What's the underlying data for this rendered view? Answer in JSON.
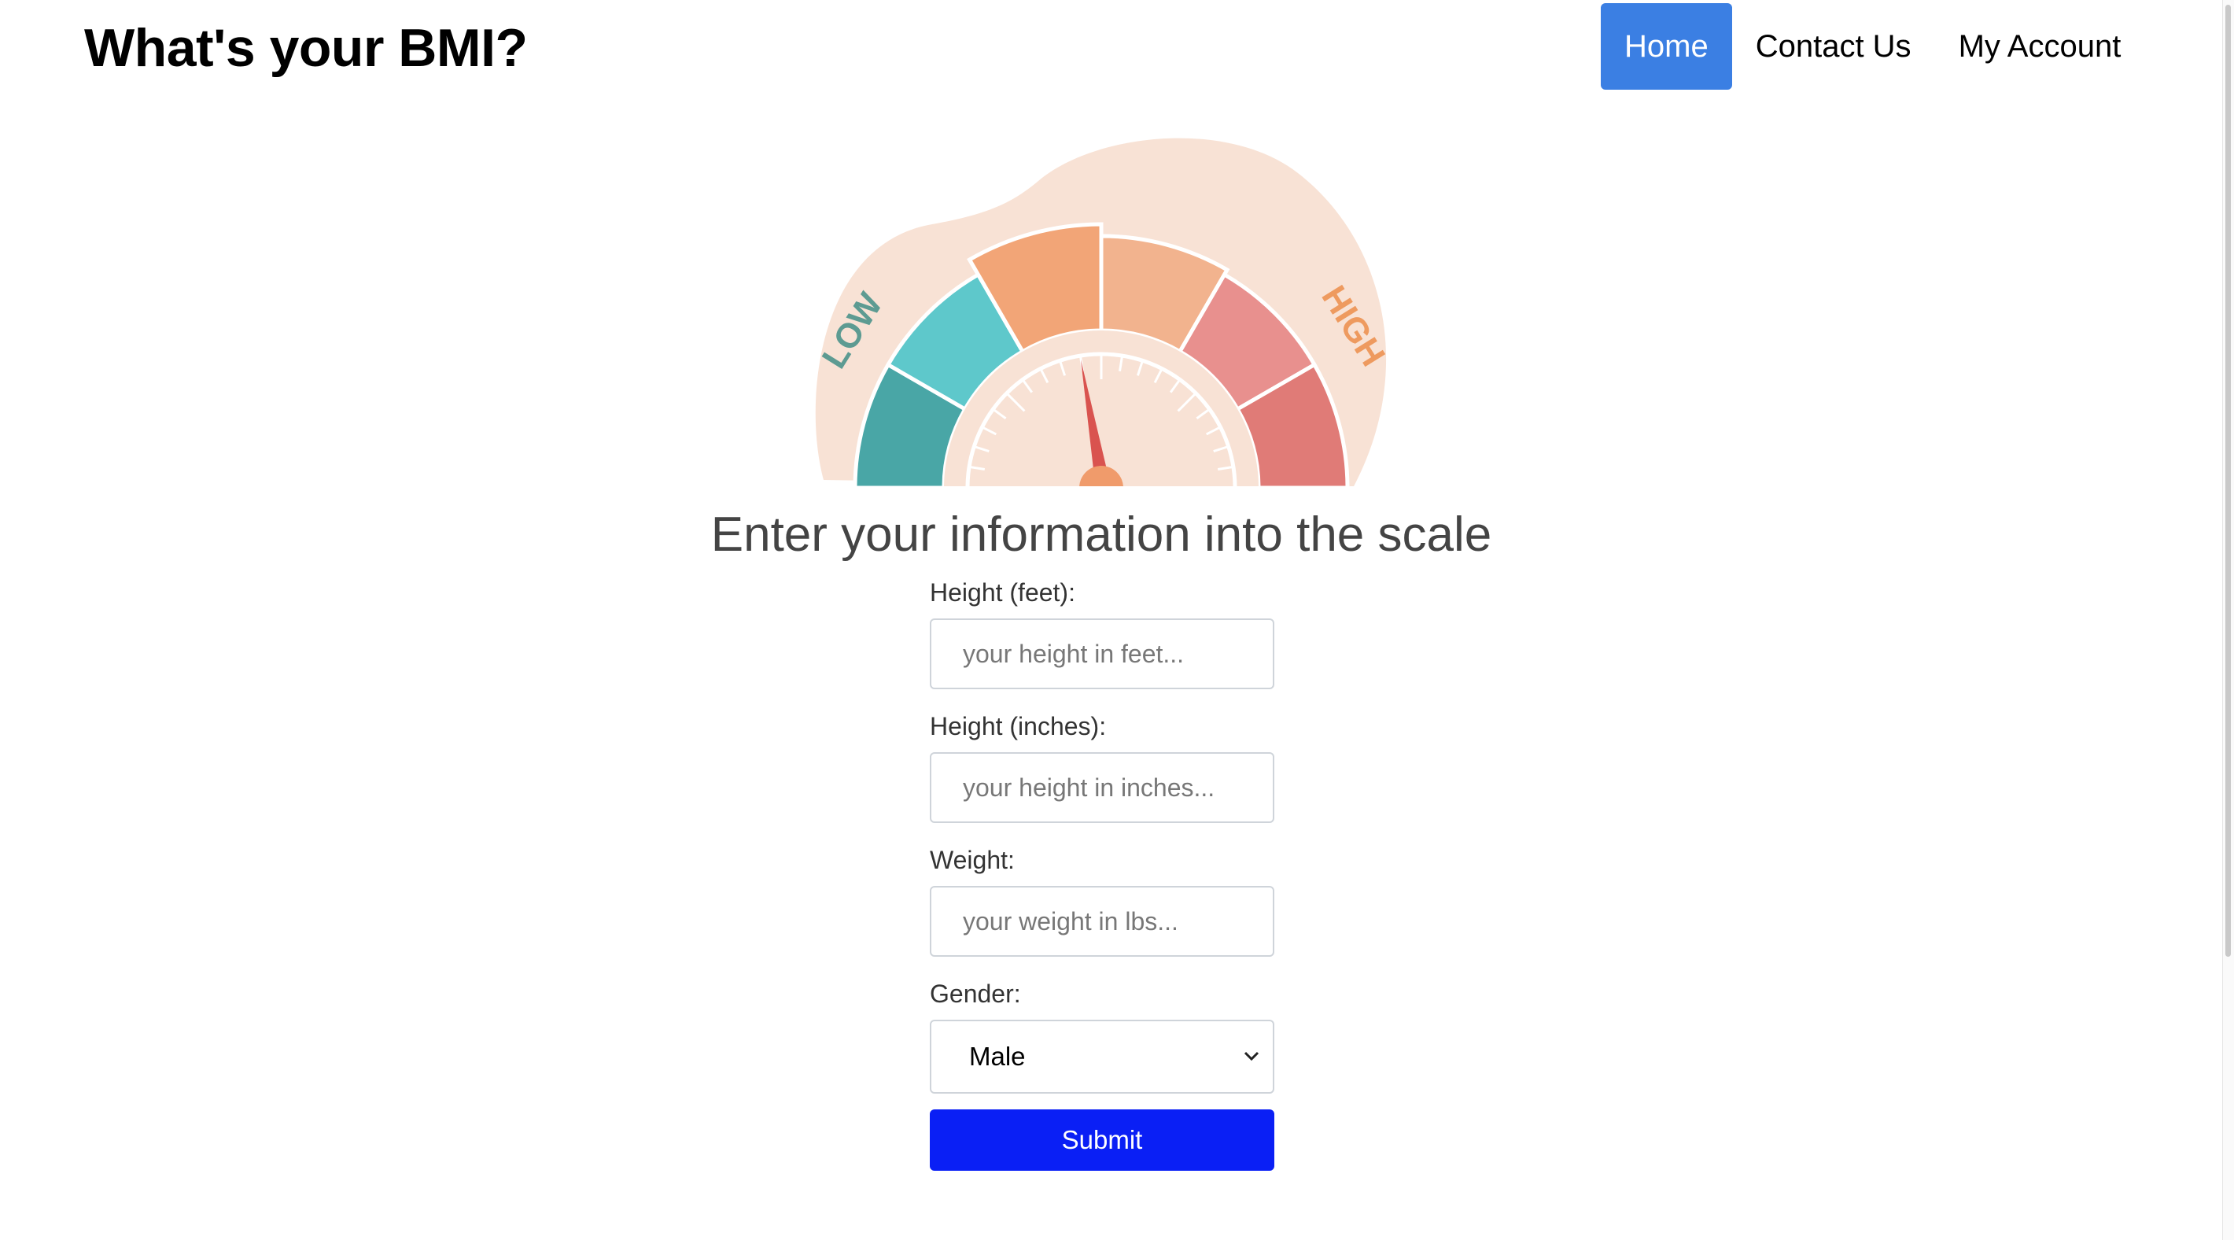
{
  "header": {
    "brand": "What's your BMI?",
    "nav": [
      {
        "label": "Home",
        "active": true
      },
      {
        "label": "Contact Us",
        "active": false
      },
      {
        "label": "My Account",
        "active": false
      }
    ]
  },
  "gauge": {
    "low_label": "LOW",
    "high_label": "HIGH",
    "segment_colors": [
      "#49a6a6",
      "#5ec8cb",
      "#f2a577",
      "#f2b38e",
      "#e8908e",
      "#e07b77"
    ],
    "blob_color": "#f8e2d5",
    "needle_color": "#d9534f",
    "hub_color": "#f09b6b"
  },
  "main": {
    "heading": "Enter your information into the scale"
  },
  "form": {
    "height_feet": {
      "label": "Height (feet):",
      "placeholder": "your height in feet..."
    },
    "height_inches": {
      "label": "Height (inches):",
      "placeholder": "your height in inches..."
    },
    "weight": {
      "label": "Weight:",
      "placeholder": "your weight in lbs..."
    },
    "gender": {
      "label": "Gender:",
      "selected": "Male"
    },
    "submit_label": "Submit"
  },
  "colors": {
    "nav_active": "#3b7fe3",
    "submit": "#0a1ff5"
  }
}
